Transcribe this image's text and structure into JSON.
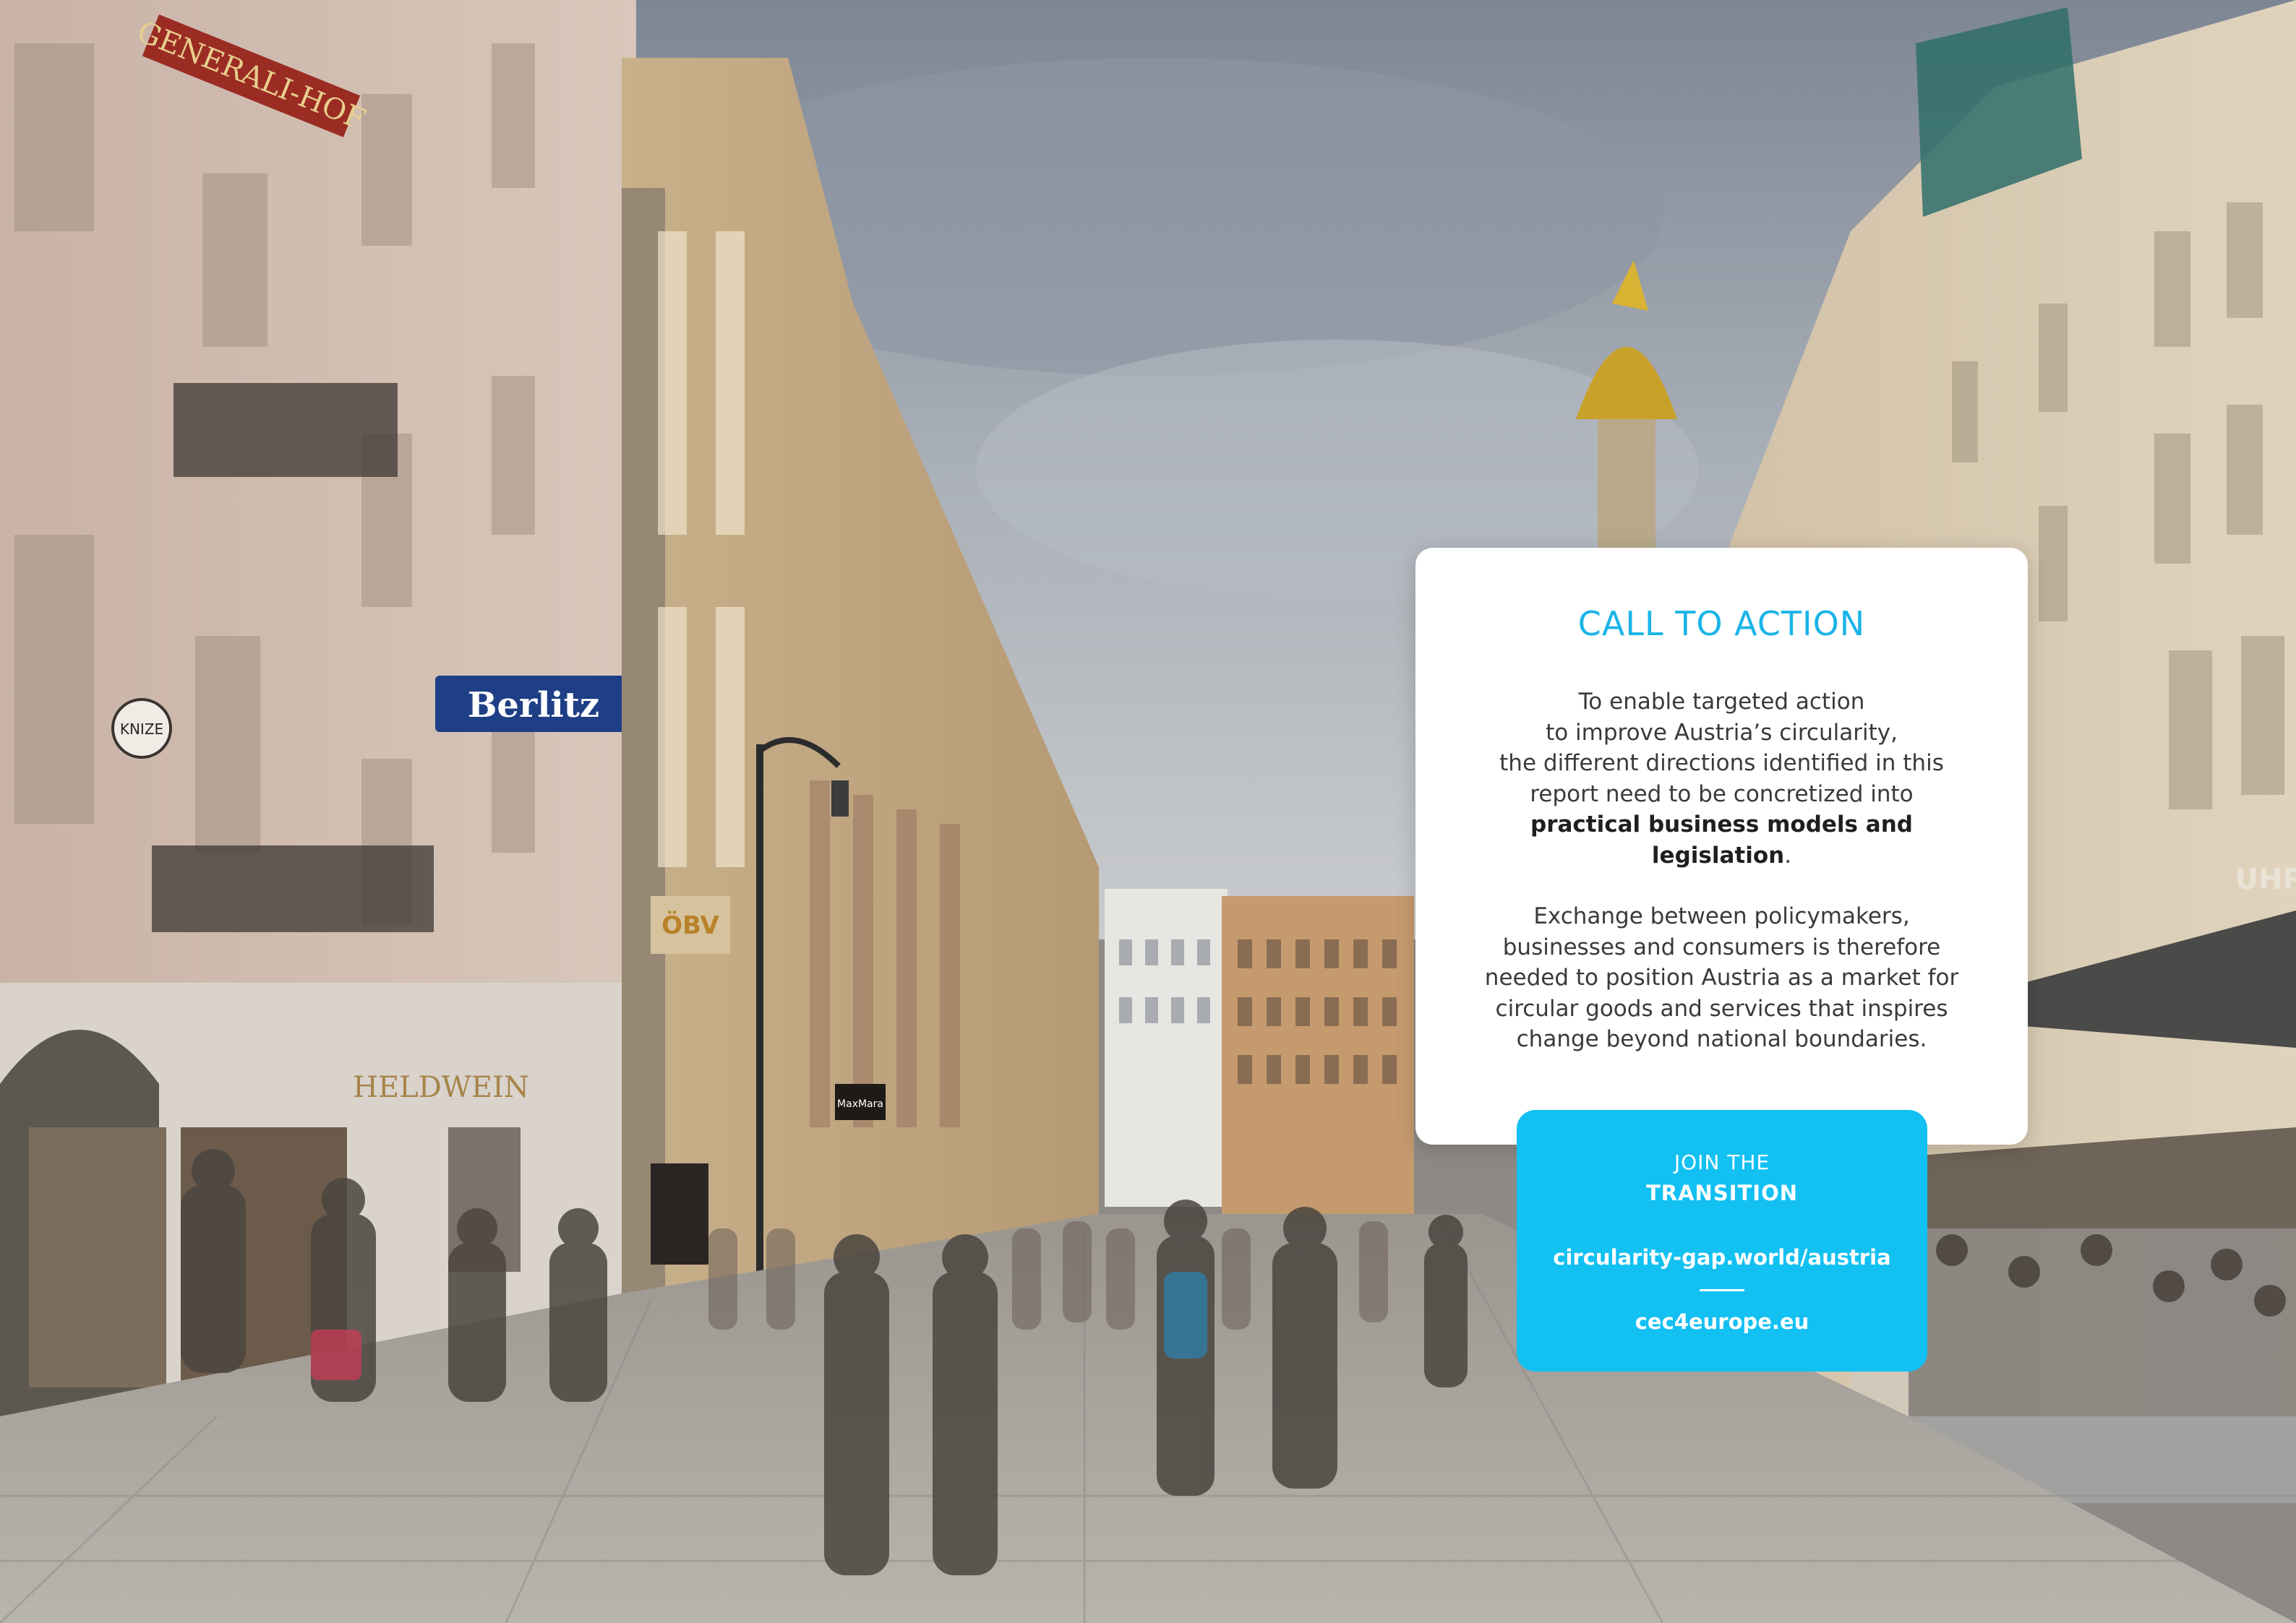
{
  "photo": {
    "signs": {
      "generali": "GENERALI-HOF",
      "berlitz": "Berlitz",
      "knize": "KNIZE",
      "heldwein": "HELDWEIN",
      "oebv": "ÖBV",
      "maxmara": "MaxMara",
      "uhren": "UHR"
    }
  },
  "call_to_action": {
    "title": "CALL TO ACTION",
    "p1_lines": [
      "To enable targeted action",
      "to improve Austria’s circularity,",
      "the different directions identified in this",
      "report need to be concretized into"
    ],
    "p1_bold_line1": "practical business models and",
    "p1_bold_line2": "legislation",
    "p1_end": ".",
    "p2_lines": [
      "Exchange between policymakers,",
      "businesses and consumers is therefore",
      "needed to position Austria as a market for",
      "circular goods and services that inspires",
      "change beyond national boundaries."
    ]
  },
  "join": {
    "line1": "JOIN THE",
    "line2": "TRANSITION",
    "url1": "circularity-gap.world/austria",
    "url2": "cec4europe.eu"
  },
  "colors": {
    "accent": "#1ab4e8",
    "join_bg": "#12c0f2"
  }
}
